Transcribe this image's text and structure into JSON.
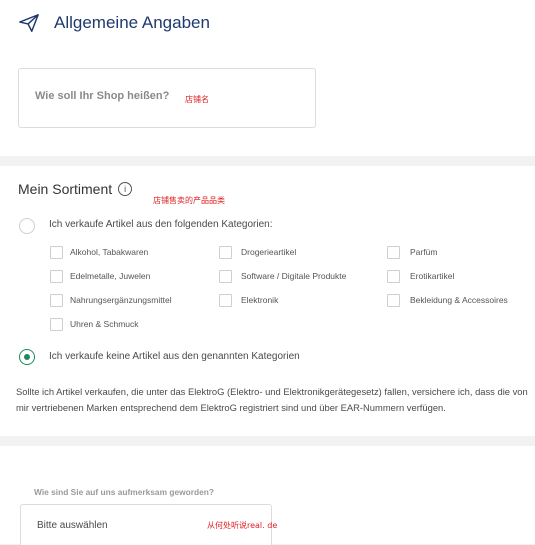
{
  "header": {
    "title": "Allgemeine Angaben",
    "icon": "paper-plane-icon"
  },
  "shop_name": {
    "placeholder": "Wie soll Ihr Shop heißen?",
    "annotation": "店铺名"
  },
  "assortment": {
    "title": "Mein Sortiment",
    "info_icon_glyph": "i",
    "annotation": "店铺售卖的产品品类",
    "option_categories": "Ich verkaufe Artikel aus den folgenden Kategorien:",
    "option_none": "Ich verkaufe keine Artikel aus den genannten Kategorien",
    "selected_option": "option_none",
    "categories": [
      "Alkohol, Tabakwaren",
      "Drogerieartikel",
      "Parfüm",
      "Edelmetalle, Juwelen",
      "Software / Digitale Produkte",
      "Erotikartikel",
      "Nahrungsergänzungsmittel",
      "Elektronik",
      "Bekleidung & Accessoires",
      "Uhren & Schmuck"
    ],
    "note": "Sollte ich Artikel verkaufen, die unter das ElektroG (Elektro- und Elektronikgerätegesetz) fallen, versichere ich, dass die von mir vertriebenen Marken entsprechend dem ElektroG registriert sind und über EAR-Nummern verfügen."
  },
  "referral": {
    "label": "Wie sind Sie auf uns aufmerksam geworden?",
    "select_value": "Bitte auswählen",
    "annotation": "从何处听说real. de"
  },
  "colors": {
    "accent": "#1d8a5a",
    "title": "#1e3a6e",
    "annotation": "#e02020"
  }
}
